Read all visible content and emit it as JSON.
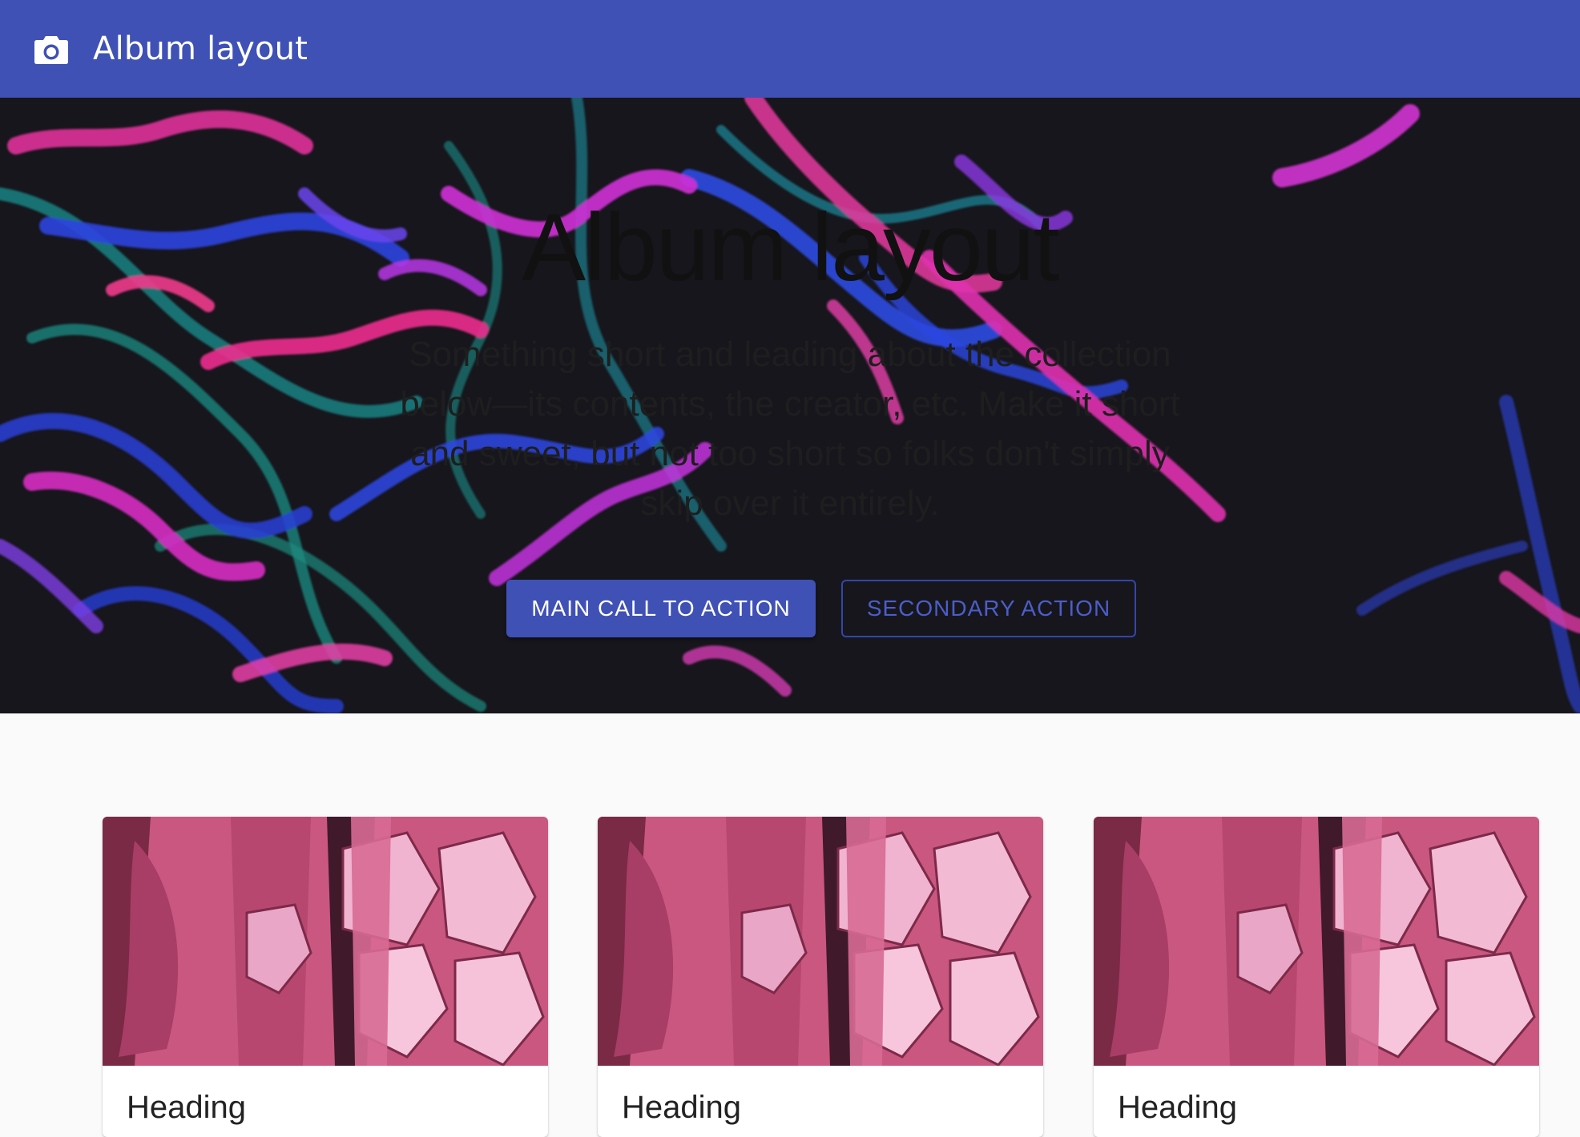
{
  "appbar": {
    "title": "Album layout",
    "icon": "camera-icon",
    "color": "#3f51b5"
  },
  "hero": {
    "title": "Album layout",
    "description": "Something short and leading about the collection below—its contents, the creator, etc. Make it short and sweet, but not too short so folks don't simply skip over it entirely.",
    "primary_button": "MAIN CALL TO ACTION",
    "secondary_button": "SECONDARY ACTION"
  },
  "cards": [
    {
      "heading": "Heading"
    },
    {
      "heading": "Heading"
    },
    {
      "heading": "Heading"
    }
  ]
}
